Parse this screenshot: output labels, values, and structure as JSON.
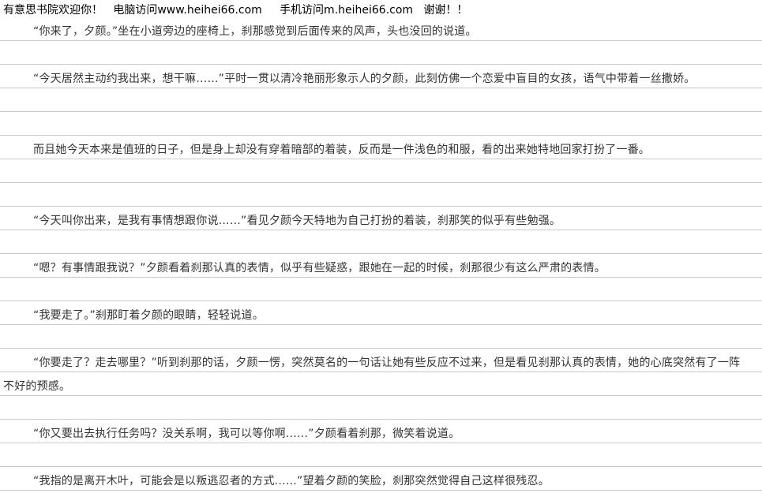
{
  "header": {
    "site": "有意思书院欢迎你！",
    "pc": "电脑访问www.heihei66.com",
    "mobile": "手机访问m.heihei66.com",
    "thanks": "谢谢！！"
  },
  "paragraphs": [
    "“你来了，夕颜。”坐在小道旁边的座椅上，刹那感觉到后面传来的风声，头也没回的说道。",
    "“今天居然主动约我出来，想干嘛……”平时一贯以清冷艳丽形象示人的夕颜，此刻仿佛一个恋爱中盲目的女孩，语气中带着一丝撒娇。",
    "而且她今天本来是值班的日子，但是身上却没有穿着暗部的着装，反而是一件浅色的和服，看的出来她特地回家打扮了一番。",
    "“今天叫你出来，是我有事情想跟你说……”看见夕颜今天特地为自己打扮的着装，刹那笑的似乎有些勉强。",
    "“嗯？有事情跟我说？”夕颜看着刹那认真的表情，似乎有些疑惑，跟她在一起的时候，刹那很少有这么严肃的表情。",
    "“我要走了。”刹那盯着夕颜的眼睛，轻轻说道。",
    "“你要走了？走去哪里？”听到刹那的话，夕颜一愣，突然莫名的一句话让她有些反应不过来，但是看见刹那认真的表情，她的心底突然有了一阵不好的预感。",
    "“你又要出去执行任务吗？没关系啊，我可以等你啊……”夕颜看着刹那，微笑着说道。",
    "“我指的是离开木叶，可能会是以叛逃忍者的方式……”望着夕颜的笑脸，刹那突然觉得自己这样很残忍。"
  ]
}
